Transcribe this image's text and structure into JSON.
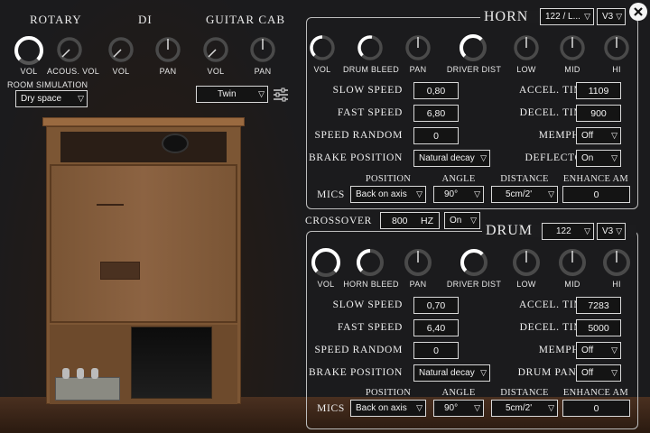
{
  "left": {
    "rotary": "ROTARY",
    "di": "DI",
    "guitar_cab": "GUITAR CAB",
    "knobs": {
      "vol": "VOL",
      "acous_vol": "ACOUS. VOL",
      "di_vol": "VOL",
      "di_pan": "PAN",
      "cab_vol": "VOL",
      "cab_pan": "PAN"
    },
    "room_simulation_label": "ROOM SIMULATION",
    "room_simulation_value": "Dry space",
    "cab_select": "Twin",
    "settings_icon": "sliders-icon"
  },
  "horn": {
    "title": "HORN",
    "preset": "122 / L...",
    "version": "V3",
    "knobs": {
      "vol": "VOL",
      "drum_bleed": "DRUM BLEED",
      "pan": "PAN",
      "driver_dist": "DRIVER DIST",
      "low": "LOW",
      "mid": "MID",
      "hi": "HI"
    },
    "slow_speed_label": "SLOW SPEED",
    "slow_speed": "0,80",
    "fast_speed_label": "FAST SPEED",
    "fast_speed": "6,80",
    "speed_random_label": "SPEED RANDOM",
    "speed_random": "0",
    "brake_label": "BRAKE POSITION",
    "brake_value": "Natural decay",
    "accel_label": "ACCEL. TIME",
    "accel": "1109",
    "decel_label": "DECEL. TIME",
    "decel": "900",
    "memphis_label": "MEMPHIS",
    "memphis": "Off",
    "deflector_label": "DEFLECTOR",
    "deflector": "On",
    "mics_label": "MICS",
    "position_label": "POSITION",
    "position": "Back on axis",
    "angle_label": "ANGLE",
    "angle": "90°",
    "distance_label": "DISTANCE",
    "distance": "5cm/2'",
    "enhance_label": "ENHANCE AM",
    "enhance": "0"
  },
  "crossover": {
    "label": "CROSSOVER",
    "value": "800",
    "unit": "HZ",
    "toggle": "On"
  },
  "drum": {
    "title": "DRUM",
    "preset": "122",
    "version": "V3",
    "knobs": {
      "vol": "VOL",
      "horn_bleed": "HORN BLEED",
      "pan": "PAN",
      "driver_dist": "DRIVER DIST",
      "low": "LOW",
      "mid": "MID",
      "hi": "HI"
    },
    "slow_speed_label": "SLOW SPEED",
    "slow_speed": "0,70",
    "fast_speed_label": "FAST SPEED",
    "fast_speed": "6,40",
    "speed_random_label": "SPEED RANDOM",
    "speed_random": "0",
    "brake_label": "BRAKE POSITION",
    "brake_value": "Natural decay",
    "accel_label": "ACCEL. TIME",
    "accel": "7283",
    "decel_label": "DECEL. TIME",
    "decel": "5000",
    "memphis_label": "MEMPHIS",
    "memphis": "Off",
    "drum_panel_label": "DRUM PANEL",
    "drum_panel": "Off",
    "mics_label": "MICS",
    "position_label": "POSITION",
    "position": "Back on axis",
    "angle_label": "ANGLE",
    "angle": "90°",
    "distance_label": "DISTANCE",
    "distance": "5cm/2'",
    "enhance_label": "ENHANCE AM",
    "enhance": "0"
  },
  "close_icon": "close-icon",
  "colors": {
    "background": "#1b1b1d",
    "text": "#e8e8e8",
    "wood": "#8a5e38",
    "border": "#d8d8d8"
  }
}
